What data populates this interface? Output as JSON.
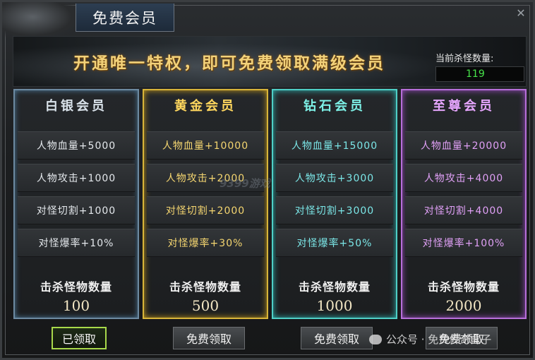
{
  "window": {
    "title": "免费会员"
  },
  "banner": {
    "headline": "开通唯一特权，即可免费领取满级会员",
    "kill_count_label": "当前杀怪数量:",
    "kill_count_value": "119"
  },
  "watermark_center": "9399游戏",
  "cards": [
    {
      "name": "白银会员",
      "rows": [
        "人物血量+5000",
        "人物攻击+1000",
        "对怪切割+1000",
        "对怪爆率+10%"
      ],
      "requirement_label": "击杀怪物数量",
      "requirement_value": "100"
    },
    {
      "name": "黄金会员",
      "rows": [
        "人物血量+10000",
        "人物攻击+2000",
        "对怪切割+2000",
        "对怪爆率+30%"
      ],
      "requirement_label": "击杀怪物数量",
      "requirement_value": "500"
    },
    {
      "name": "钻石会员",
      "rows": [
        "人物血量+15000",
        "人物攻击+3000",
        "对怪切割+3000",
        "对怪爆率+50%"
      ],
      "requirement_label": "击杀怪物数量",
      "requirement_value": "1000"
    },
    {
      "name": "至尊会员",
      "rows": [
        "人物血量+20000",
        "人物攻击+4000",
        "对怪切割+4000",
        "对怪爆率+100%"
      ],
      "requirement_label": "击杀怪物数量",
      "requirement_value": "2000"
    }
  ],
  "buttons": {
    "claimed": "已领取",
    "claim": "免费领取"
  },
  "overlay_watermark": "公众号 · 免费传奇盒子",
  "colors": {
    "silver": "#6d8aa1",
    "gold": "#d8b53a",
    "diamond": "#4fcfc6",
    "supreme": "#b76fd9",
    "kill_count": "#47e44a",
    "claimed_border": "#a8d94a"
  }
}
